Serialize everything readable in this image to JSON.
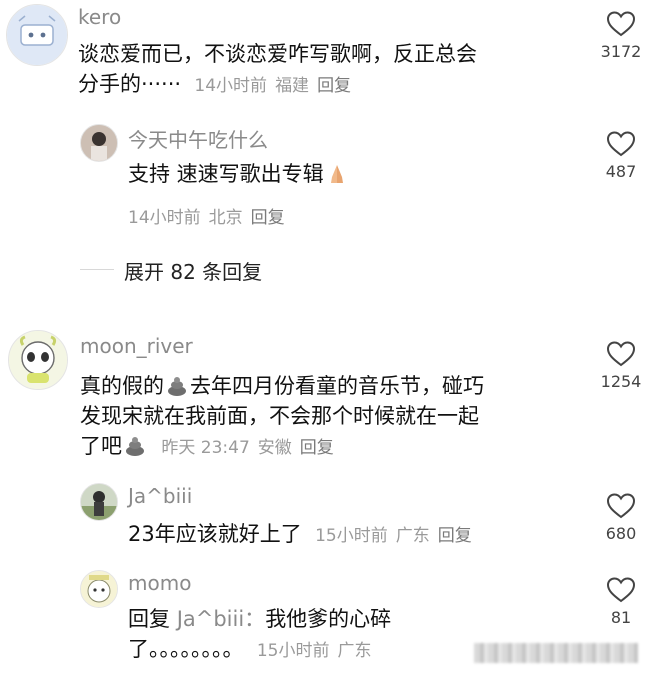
{
  "comments": [
    {
      "username": "kero",
      "text_lines": [
        "谈恋爱而已，不谈恋爱咋写歌啊，反正总会",
        "分手的······"
      ],
      "time": "14小时前",
      "location": "福建",
      "reply_label": "回复",
      "likes": "3172"
    },
    {
      "username": "今天中午吃什么",
      "text_main": "支持 速速写歌出专辑",
      "time": "14小时前",
      "location": "北京",
      "reply_label": "回复",
      "likes": "487"
    },
    {
      "expand_label": "展开 82 条回复"
    },
    {
      "username": "moon_river",
      "text_lines": [
        "真的假的",
        "去年四月份看童的音乐节，碰巧",
        "发现宋就在我前面，不会那个时候就在一起",
        "了吧"
      ],
      "time": "昨天 23:47",
      "location": "安徽",
      "reply_label": "回复",
      "likes": "1254"
    },
    {
      "username": "Ja^biii",
      "text_main": "23年应该就好上了",
      "time": "15小时前",
      "location": "广东",
      "reply_label": "回复",
      "likes": "680"
    },
    {
      "username": "momo",
      "reply_prefix": "回复",
      "reply_target": "Ja^biii：",
      "text_main": "我他爹的心碎",
      "text_line2": "了。。。。。。。。",
      "time": "15小时前",
      "location": "广东",
      "likes": "81"
    }
  ]
}
